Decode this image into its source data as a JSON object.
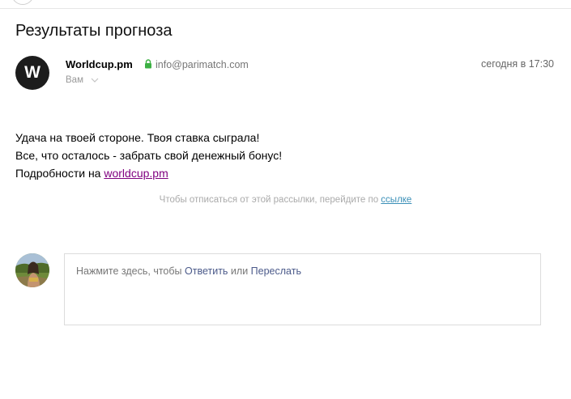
{
  "subject": "Результаты прогноза",
  "sender": {
    "avatar_letter": "W",
    "name": "Worldcup.pm",
    "email": "info@parimatch.com",
    "date": "сегодня в 17:30",
    "recipient": "Вам"
  },
  "body": {
    "line1": "Удача на твоей стороне. Твоя ставка сыграла!",
    "line2": "Все, что осталось - забрать свой денежный бонус!",
    "line3_prefix": "Подробности на ",
    "link_text": "worldcup.pm"
  },
  "unsubscribe": {
    "text": "Чтобы отписаться от этой рассылки, перейдите по ",
    "link_text": "ссылке"
  },
  "reply": {
    "prefix": "Нажмите здесь, чтобы ",
    "reply_label": "Ответить",
    "or_text": " или ",
    "forward_label": "Переслать"
  },
  "colors": {
    "link_visited": "#800080",
    "unsubscribe_link": "#3a8fb7",
    "secure_lock": "#3cb043",
    "reply_action": "#4b5a8a"
  },
  "icons": [
    "lock-icon",
    "chevron-down-icon"
  ]
}
